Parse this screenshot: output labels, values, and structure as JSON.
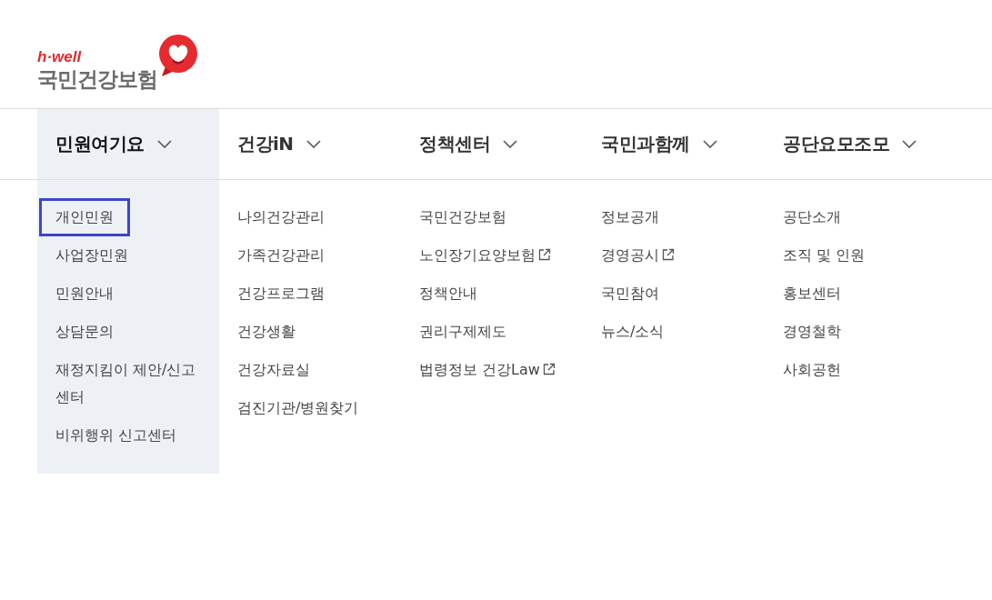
{
  "logo": {
    "tagline": "h·well",
    "name": "국민건강보험"
  },
  "menus": [
    {
      "label": "민원여기요",
      "selected": true,
      "items": [
        {
          "label": "개인민원",
          "focused": true,
          "external": false
        },
        {
          "label": "사업장민원",
          "focused": false,
          "external": false
        },
        {
          "label": "민원안내",
          "focused": false,
          "external": false
        },
        {
          "label": "상담문의",
          "focused": false,
          "external": false
        },
        {
          "label": "재정지킴이 제안/신고 센터",
          "focused": false,
          "external": false
        },
        {
          "label": "비위행위 신고센터",
          "focused": false,
          "external": false
        }
      ]
    },
    {
      "label": "건강iN",
      "selected": false,
      "items": [
        {
          "label": "나의건강관리",
          "focused": false,
          "external": false
        },
        {
          "label": "가족건강관리",
          "focused": false,
          "external": false
        },
        {
          "label": "건강프로그램",
          "focused": false,
          "external": false
        },
        {
          "label": "건강생활",
          "focused": false,
          "external": false
        },
        {
          "label": "건강자료실",
          "focused": false,
          "external": false
        },
        {
          "label": "검진기관/병원찾기",
          "focused": false,
          "external": false
        }
      ]
    },
    {
      "label": "정책센터",
      "selected": false,
      "items": [
        {
          "label": "국민건강보험",
          "focused": false,
          "external": false
        },
        {
          "label": "노인장기요양보험",
          "focused": false,
          "external": true
        },
        {
          "label": "정책안내",
          "focused": false,
          "external": false
        },
        {
          "label": "권리구제제도",
          "focused": false,
          "external": false
        },
        {
          "label": "법령정보 건강Law",
          "focused": false,
          "external": true
        }
      ]
    },
    {
      "label": "국민과함께",
      "selected": false,
      "items": [
        {
          "label": "정보공개",
          "focused": false,
          "external": false
        },
        {
          "label": "경영공시",
          "focused": false,
          "external": true
        },
        {
          "label": "국민참여",
          "focused": false,
          "external": false
        },
        {
          "label": "뉴스/소식",
          "focused": false,
          "external": false
        }
      ]
    },
    {
      "label": "공단요모조모",
      "selected": false,
      "items": [
        {
          "label": "공단소개",
          "focused": false,
          "external": false
        },
        {
          "label": "조직 및 인원",
          "focused": false,
          "external": false
        },
        {
          "label": "홍보센터",
          "focused": false,
          "external": false
        },
        {
          "label": "경영철학",
          "focused": false,
          "external": false
        },
        {
          "label": "사회공헌",
          "focused": false,
          "external": false
        }
      ]
    }
  ]
}
